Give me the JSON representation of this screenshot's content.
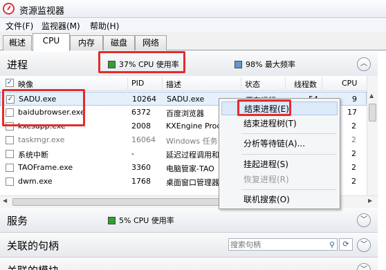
{
  "window": {
    "title": "资源监视器"
  },
  "menu": [
    "文件(F)",
    "监视器(M)",
    "帮助(H)"
  ],
  "tabs": [
    "概述",
    "CPU",
    "内存",
    "磁盘",
    "网络"
  ],
  "process_section": {
    "title": "进程",
    "cpu_usage": "37% CPU 使用率",
    "max_freq": "98% 最大频率",
    "columns": [
      "映像",
      "PID",
      "描述",
      "状态",
      "线程数",
      "CPU"
    ],
    "rows": [
      {
        "image": "SADU.exe",
        "pid": "10264",
        "desc": "SADU.exe",
        "status": "正在运行",
        "threads": "54",
        "cpu": "9",
        "checked": true
      },
      {
        "image": "baidubrowser.exe",
        "pid": "6372",
        "desc": "百度浏览器",
        "status": "",
        "threads": "",
        "cpu": "17",
        "checked": false
      },
      {
        "image": "kxesapp.exe",
        "pid": "2008",
        "desc": "KXEngine Prod",
        "status": "",
        "threads": "",
        "cpu": "2",
        "checked": false
      },
      {
        "image": "taskmgr.exe",
        "pid": "16064",
        "desc": "Windows 任务",
        "status": "",
        "threads": "",
        "cpu": "2",
        "checked": false
      },
      {
        "image": "系统中断",
        "pid": "-",
        "desc": "延迟过程调用和",
        "status": "",
        "threads": "",
        "cpu": "2",
        "checked": false
      },
      {
        "image": "TAOFrame.exe",
        "pid": "3360",
        "desc": "电脑管家-TAO",
        "status": "",
        "threads": "",
        "cpu": "2",
        "checked": false
      },
      {
        "image": "dwm.exe",
        "pid": "1768",
        "desc": "桌面窗口管理器",
        "status": "",
        "threads": "",
        "cpu": "2",
        "checked": false
      }
    ]
  },
  "context_menu": [
    "结束进程(E)",
    "结束进程树(T)",
    "分析等待链(A)...",
    "挂起进程(S)",
    "恢复进程(R)",
    "联机搜索(O)"
  ],
  "services_section": {
    "title": "服务",
    "cpu_usage": "5% CPU 使用率"
  },
  "handles_section": {
    "title": "关联的句柄",
    "search_placeholder": "搜索句柄"
  },
  "modules_section": {
    "title": "关联的模块"
  },
  "colors": {
    "cpu_green": "#2fa12f",
    "freq_blue": "#5b9bd5",
    "annotation_red": "#e52a2a"
  }
}
